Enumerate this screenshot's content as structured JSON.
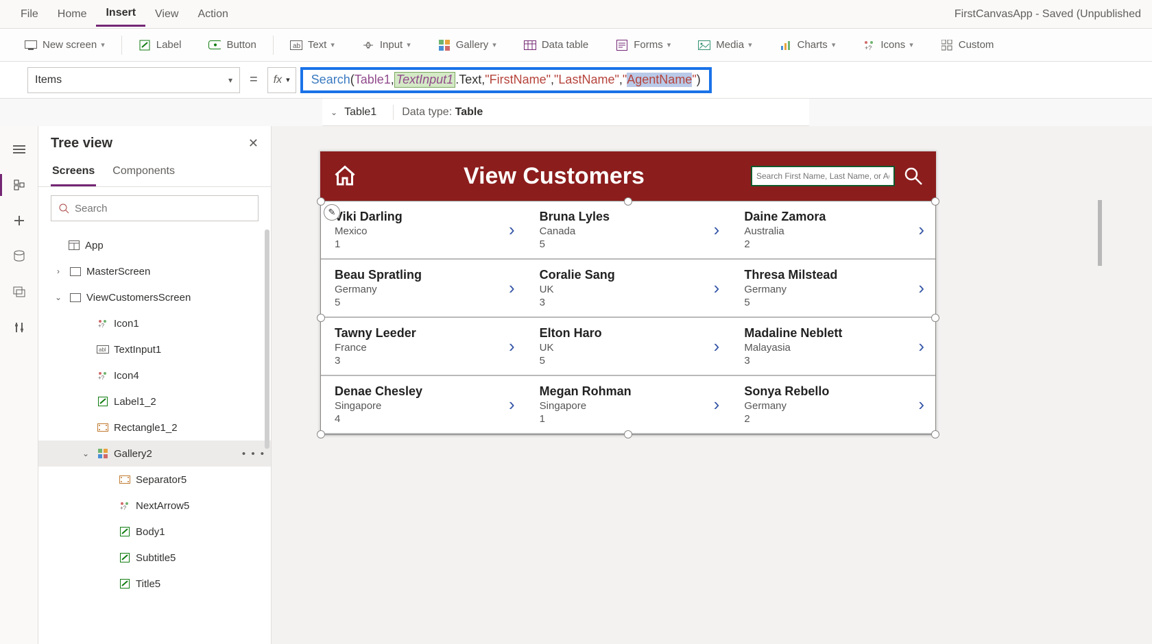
{
  "app_title": "FirstCanvasApp - Saved (Unpublished",
  "menubar": [
    "File",
    "Home",
    "Insert",
    "View",
    "Action"
  ],
  "menubar_active": 2,
  "ribbon": {
    "new_screen": "New screen",
    "label": "Label",
    "button": "Button",
    "text": "Text",
    "input": "Input",
    "gallery": "Gallery",
    "data_table": "Data table",
    "forms": "Forms",
    "media": "Media",
    "charts": "Charts",
    "icons": "Icons",
    "custom": "Custom"
  },
  "property_dd": "Items",
  "eq": "=",
  "fx": "fx",
  "formula": {
    "fn": "Search",
    "arg_table": "Table1",
    "arg_ctrl": "TextInput1",
    "arg_prop": ".Text",
    "str1": "\"FirstName\"",
    "str2": "\"LastName\"",
    "str3_open": "\"",
    "str3_sel": "AgentName",
    "str3_close": "\""
  },
  "intelli": {
    "name": "Table1",
    "dtype_label": "Data type:",
    "dtype": "Table"
  },
  "tree": {
    "title": "Tree view",
    "tabs": [
      "Screens",
      "Components"
    ],
    "tabs_active": 0,
    "search_ph": "Search",
    "nodes": [
      {
        "depth": 0,
        "icon": "app",
        "label": "App",
        "twisty": ""
      },
      {
        "depth": 1,
        "icon": "screen",
        "label": "MasterScreen",
        "twisty": "›"
      },
      {
        "depth": 1,
        "icon": "screen",
        "label": "ViewCustomersScreen",
        "twisty": "⌄"
      },
      {
        "depth": 3,
        "icon": "iconctrl",
        "label": "Icon1",
        "twisty": ""
      },
      {
        "depth": 3,
        "icon": "textinput",
        "label": "TextInput1",
        "twisty": ""
      },
      {
        "depth": 3,
        "icon": "iconctrl",
        "label": "Icon4",
        "twisty": ""
      },
      {
        "depth": 3,
        "icon": "labelctrl",
        "label": "Label1_2",
        "twisty": ""
      },
      {
        "depth": 3,
        "icon": "rect",
        "label": "Rectangle1_2",
        "twisty": ""
      },
      {
        "depth": 3,
        "icon": "gallery",
        "label": "Gallery2",
        "twisty": "⌄",
        "sel": true,
        "dots": true
      },
      {
        "depth": 4,
        "icon": "rect",
        "label": "Separator5",
        "twisty": ""
      },
      {
        "depth": 4,
        "icon": "iconctrl",
        "label": "NextArrow5",
        "twisty": ""
      },
      {
        "depth": 4,
        "icon": "labelctrl",
        "label": "Body1",
        "twisty": ""
      },
      {
        "depth": 4,
        "icon": "labelctrl",
        "label": "Subtitle5",
        "twisty": ""
      },
      {
        "depth": 4,
        "icon": "labelctrl",
        "label": "Title5",
        "twisty": ""
      }
    ]
  },
  "preview": {
    "title": "View Customers",
    "search_ph": "Search First Name, Last Name, or Age",
    "rows": [
      [
        {
          "name": "Viki  Darling",
          "country": "Mexico",
          "num": "1"
        },
        {
          "name": "Bruna  Lyles",
          "country": "Canada",
          "num": "5"
        },
        {
          "name": "Daine  Zamora",
          "country": "Australia",
          "num": "2"
        }
      ],
      [
        {
          "name": "Beau  Spratling",
          "country": "Germany",
          "num": "5"
        },
        {
          "name": "Coralie  Sang",
          "country": "UK",
          "num": "3"
        },
        {
          "name": "Thresa  Milstead",
          "country": "Germany",
          "num": "5"
        }
      ],
      [
        {
          "name": "Tawny  Leeder",
          "country": "France",
          "num": "3"
        },
        {
          "name": "Elton  Haro",
          "country": "UK",
          "num": "5"
        },
        {
          "name": "Madaline  Neblett",
          "country": "Malayasia",
          "num": "3"
        }
      ],
      [
        {
          "name": "Denae  Chesley",
          "country": "Singapore",
          "num": "4"
        },
        {
          "name": "Megan  Rohman",
          "country": "Singapore",
          "num": "1"
        },
        {
          "name": "Sonya  Rebello",
          "country": "Germany",
          "num": "2"
        }
      ]
    ]
  }
}
